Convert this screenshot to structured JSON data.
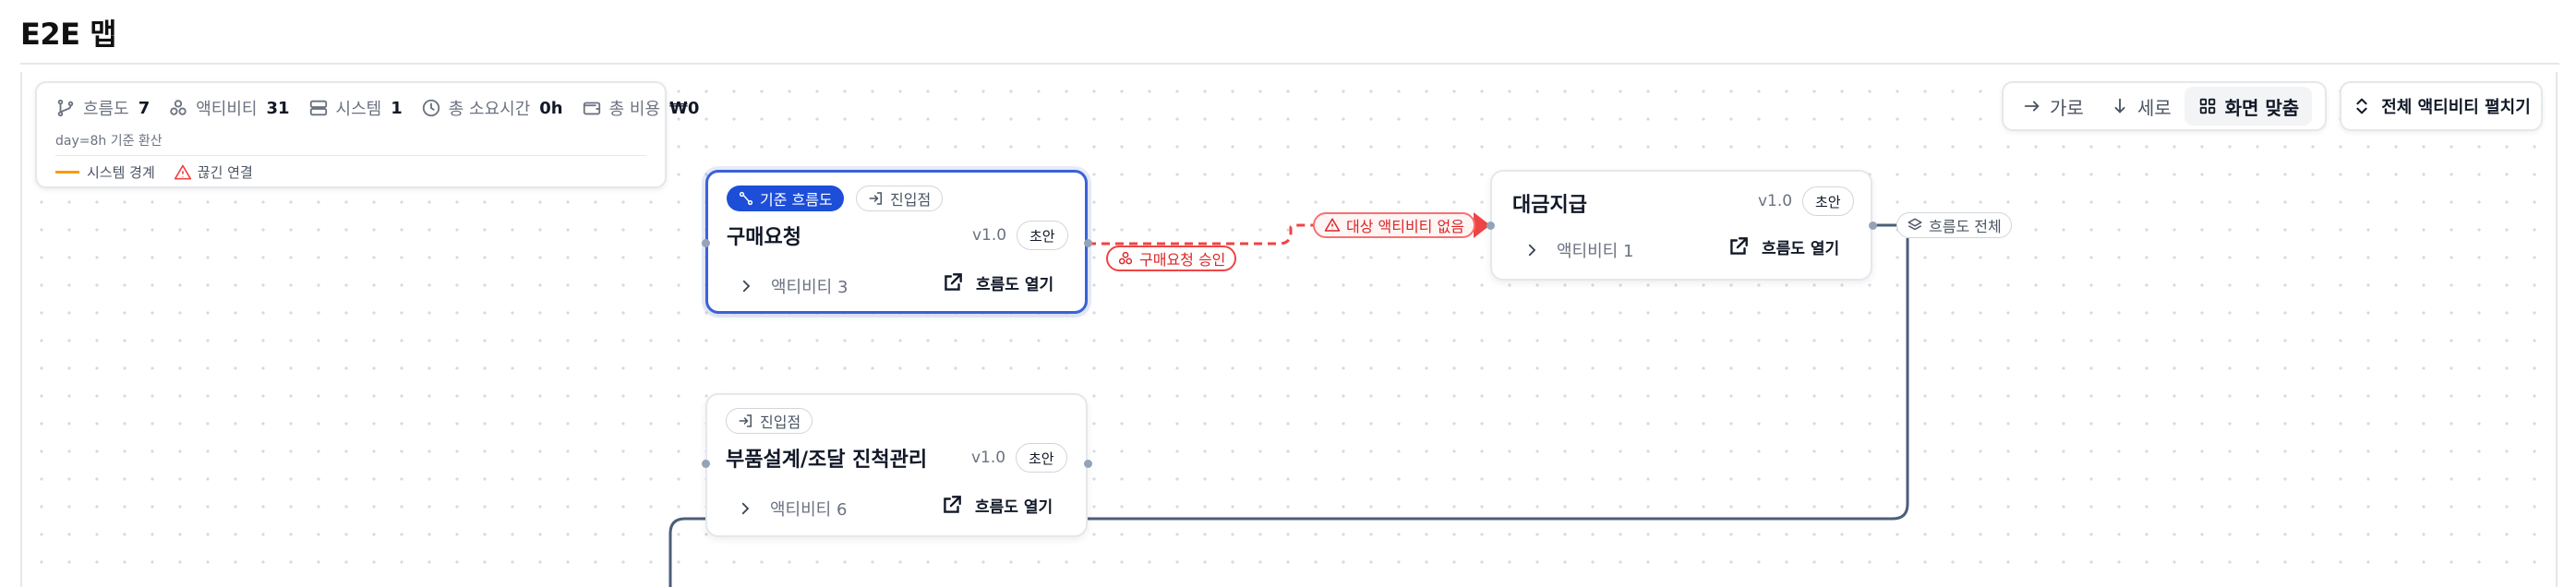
{
  "page": {
    "title": "E2E 맵"
  },
  "stats": {
    "flows": {
      "label": "흐름도",
      "value": "7"
    },
    "activities": {
      "label": "액티비티",
      "value": "31"
    },
    "systems": {
      "label": "시스템",
      "value": "1"
    },
    "duration": {
      "label": "총 소요시간",
      "value": "0h"
    },
    "cost": {
      "label": "총 비용",
      "value": "₩0"
    },
    "note": "day=8h 기준 환산",
    "legend": {
      "system_boundary": "시스템 경계",
      "broken_link": "끊긴 연결"
    }
  },
  "toolbar": {
    "horizontal": "가로",
    "vertical": "세로",
    "fit": "화면 맞춤",
    "expand_all": "전체 액티비티 펼치기"
  },
  "cards": [
    {
      "id": "purchase",
      "badge_primary": "기준 흐름도",
      "badge_entry": "진입점",
      "title": "구매요청",
      "version": "v1.0",
      "status": "초안",
      "activities": "액티비티 3",
      "open": "흐름도 열기"
    },
    {
      "id": "payment",
      "title": "대금지급",
      "version": "v1.0",
      "status": "초안",
      "activities": "액티비티 1",
      "open": "흐름도 열기"
    },
    {
      "id": "parts",
      "badge_entry": "진입점",
      "title": "부품설계/조달 진척관리",
      "version": "v1.0",
      "status": "초안",
      "activities": "액티비티 6",
      "open": "흐름도 열기"
    }
  ],
  "edges": {
    "approval_label": "구매요청 승인",
    "missing_target": "대상 액티비티 없음",
    "whole_flow": "흐름도 전체"
  },
  "colors": {
    "accent": "#1d4ed8",
    "selected_border": "#3b62d6",
    "broken": "#ef4444",
    "boundary": "#f59e0b",
    "edge": "#4b5e7a"
  },
  "icons": [
    "branch-icon",
    "activity-icon",
    "server-icon",
    "clock-icon",
    "wallet-icon",
    "warning-icon",
    "arrow-right-icon",
    "arrow-down-icon",
    "grid-icon",
    "chevrons-updown-icon",
    "entry-icon",
    "chevron-right-icon",
    "external-link-icon",
    "layers-icon"
  ]
}
